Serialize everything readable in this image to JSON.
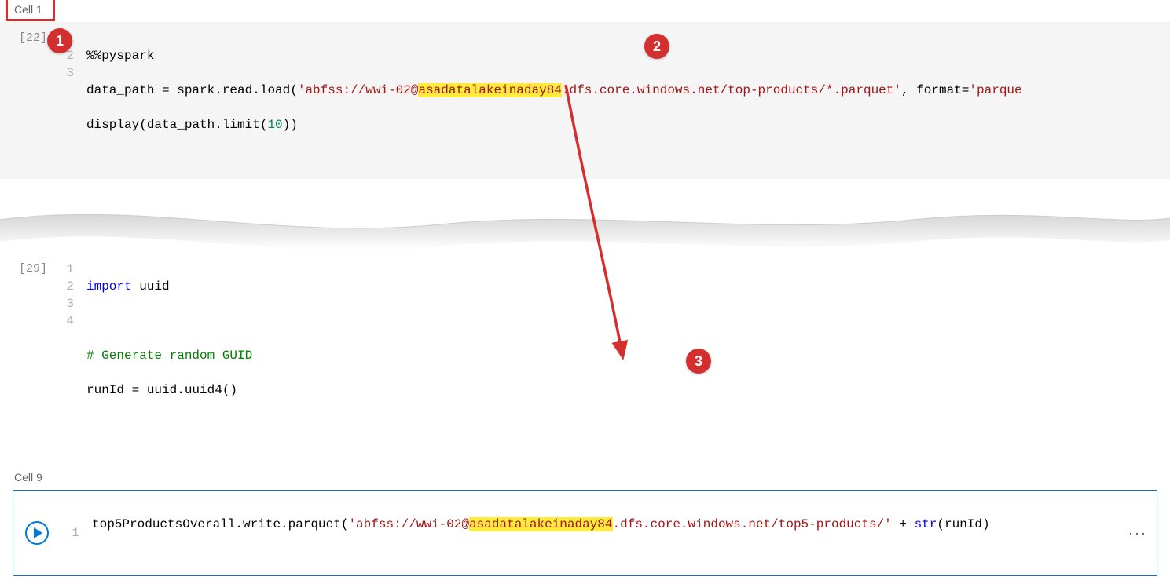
{
  "cell1": {
    "label": "Cell 1",
    "exec_count": "[22]",
    "line_numbers": [
      "1",
      "2",
      "3"
    ],
    "line1": {
      "magic": "%%pyspark"
    },
    "line2": {
      "p1": "data_path = spark.read.load(",
      "str_pre": "'abfss://wwi-02@",
      "str_hl": "asadatalakeinaday84",
      "str_post": ".dfs.core.windows.net/top-products/*.parquet'",
      "p2": ", format=",
      "str2": "'parque"
    },
    "line3": {
      "p1": "display(data_path.limit(",
      "num": "10",
      "p2": "))"
    }
  },
  "cell_mid": {
    "exec_count": "[29]",
    "line_numbers": [
      "1",
      "2",
      "3",
      "4"
    ],
    "line1": {
      "kw": "import",
      "rest": " uuid"
    },
    "line2": "",
    "line3": {
      "comment": "# Generate random GUID"
    },
    "line4": {
      "p1": "runId = uuid.uuid4()"
    }
  },
  "cell9": {
    "label": "Cell 9",
    "line_numbers": [
      "1"
    ],
    "line1": {
      "p1": "top5ProductsOverall.write.parquet(",
      "str_pre": "'abfss://wwi-02@",
      "str_hl": "asadatalakeinaday84",
      "str_post": ".dfs.core.windows.net/top5-products/'",
      "p2": " + ",
      "func": "str",
      "p3": "(runId) "
    }
  },
  "callouts": {
    "c1": "1",
    "c2": "2",
    "c3": "3"
  }
}
